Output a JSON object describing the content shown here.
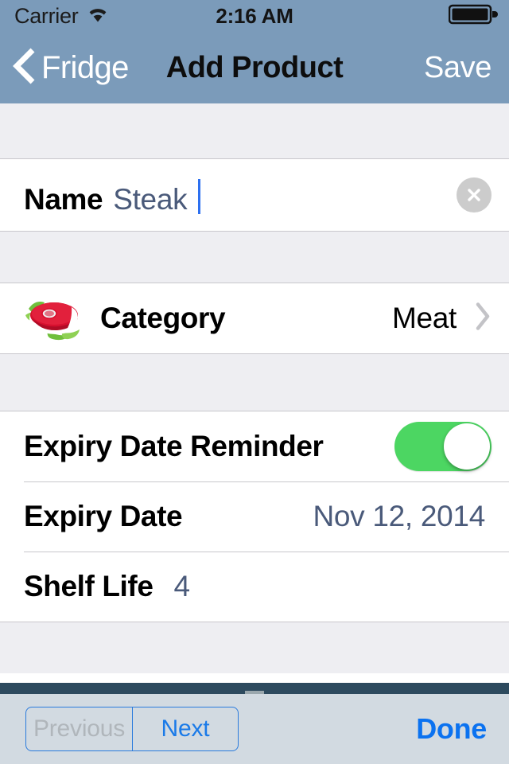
{
  "status_bar": {
    "carrier": "Carrier",
    "wifi_icon": "wifi-icon",
    "time": "2:16 AM",
    "battery_icon": "battery-full-icon"
  },
  "nav_bar": {
    "back_icon": "chevron-left-icon",
    "back_label": "Fridge",
    "title": "Add Product",
    "save_label": "Save"
  },
  "form": {
    "name_row": {
      "label": "Name",
      "value": "Steak",
      "placeholder": "Name",
      "clear_icon": "clear-circle-icon"
    },
    "category_row": {
      "icon": "steak-icon",
      "label": "Category",
      "value": "Meat",
      "disclosure_icon": "chevron-right-icon"
    },
    "reminder_row": {
      "label": "Expiry Date Reminder",
      "switch_state": "on"
    },
    "expiry_row": {
      "label": "Expiry Date",
      "value": "Nov 12, 2014"
    },
    "shelf_row": {
      "label": "Shelf Life",
      "value": "4"
    }
  },
  "keyboard_toolbar": {
    "previous_label": "Previous",
    "next_label": "Next",
    "done_label": "Done"
  },
  "colors": {
    "nav_bar": "#7b9bba",
    "accent_blue": "#0b72f0",
    "value_blue": "#4a5a7a",
    "switch_on": "#4cd662",
    "group_background": "#eeeef2",
    "toolbar": "#d2dae1",
    "dark_bar": "#2d4a5e"
  }
}
